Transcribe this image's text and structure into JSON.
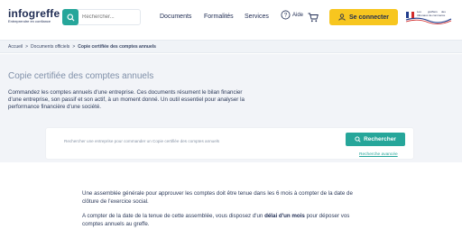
{
  "header": {
    "logo_text": "infogreffe",
    "logo_tagline": "Entreprendre en confiance",
    "search_placeholder": "Rechercher...",
    "nav": [
      "Documents",
      "Formalités",
      "Services"
    ],
    "aide_label": "Aide",
    "connect_label": "Se connecter",
    "gov_logo_lines": [
      "Les",
      "greffiers",
      "des",
      "tribunaux de commerce"
    ]
  },
  "breadcrumb": {
    "items": [
      "Accueil",
      "Documents officiels",
      "Copie certifiée des comptes annuels"
    ],
    "separator": ">"
  },
  "hero": {
    "title": "Copie certifiée des comptes annuels",
    "description": "Commandez les comptes annuels d'une entreprise. Ces documents résument le bilan financier d'une entreprise, son passif et son actif, à un moment donné. Un outil essentiel pour analyser la performance financière d'une société."
  },
  "search_panel": {
    "placeholder": "Rechercher une entreprise pour commander un Copie certifiée des comptes annuels",
    "button_label": "Rechercher",
    "advanced_link": "Recherche avancée"
  },
  "content": {
    "p1": "Une assemblée générale pour approuver les comptes doit être tenue dans les 6 mois à compter de la date de clôture de l'exercice social.",
    "p2_before": "A compter de la date de la tenue de cette assemblée, vous disposez d'un ",
    "p2_bold": "délai d'un mois",
    "p2_after": " pour déposer vos comptes annuels au greffe."
  },
  "colors": {
    "accent_teal": "#26a69a",
    "connect_yellow": "#f7c61f",
    "navy": "#1e2b52",
    "hero_bg": "#f2f4f8"
  }
}
